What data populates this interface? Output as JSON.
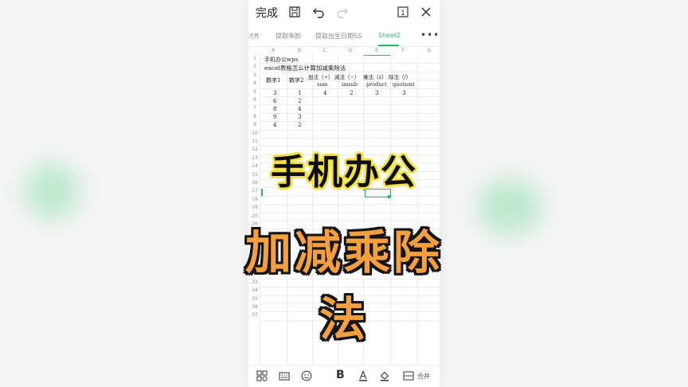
{
  "topbar": {
    "done_label": "完成"
  },
  "tabs": [
    {
      "label": "讨齐",
      "active": false
    },
    {
      "label": "提取年龄",
      "active": false
    },
    {
      "label": "提取出生日期SS",
      "active": false
    },
    {
      "label": "Sheet2",
      "active": true
    }
  ],
  "sheet": {
    "columns": [
      "A",
      "B",
      "C",
      "D",
      "E",
      "F",
      "G"
    ],
    "rows": [
      "1",
      "2",
      "3",
      "4",
      "5",
      "6",
      "7",
      "8",
      "9",
      "10",
      "11",
      "12",
      "13",
      "14",
      "15",
      "16",
      "17",
      "18",
      "19",
      "20",
      "26",
      "27",
      "28",
      "29",
      "30",
      "31",
      "32",
      "33",
      "34",
      "35",
      "36",
      "37"
    ],
    "cells": {
      "r1a": "手机办公wps",
      "r2a": "excel表格怎么计算加减乘除法",
      "r3a": "数字1",
      "r3b": "数字2",
      "r3c": "加法（+）",
      "r3d": "减法（−）",
      "r3e": "乘法（x）",
      "r3f": "除法（/）",
      "r4c": "sum",
      "r4d": "imsub",
      "r4e": "product",
      "r4f": "quotient",
      "r5a": "3",
      "r5b": "1",
      "r5c": "4",
      "r5d": "2",
      "r5e": "3",
      "r5f": "3",
      "r6a": "6",
      "r6b": "2",
      "r7a": "8",
      "r7b": "4",
      "r8a": "9",
      "r8b": "3",
      "r9a": "4",
      "r9b": "2"
    }
  },
  "bottombar": {
    "merge_label": "合并"
  },
  "overlay": {
    "line1": "手机办公",
    "line2": "加减乘除法"
  },
  "colors": {
    "accent": "#2fb86a",
    "caption_yellow": "#f2e040",
    "caption_orange": "#f5a040"
  }
}
